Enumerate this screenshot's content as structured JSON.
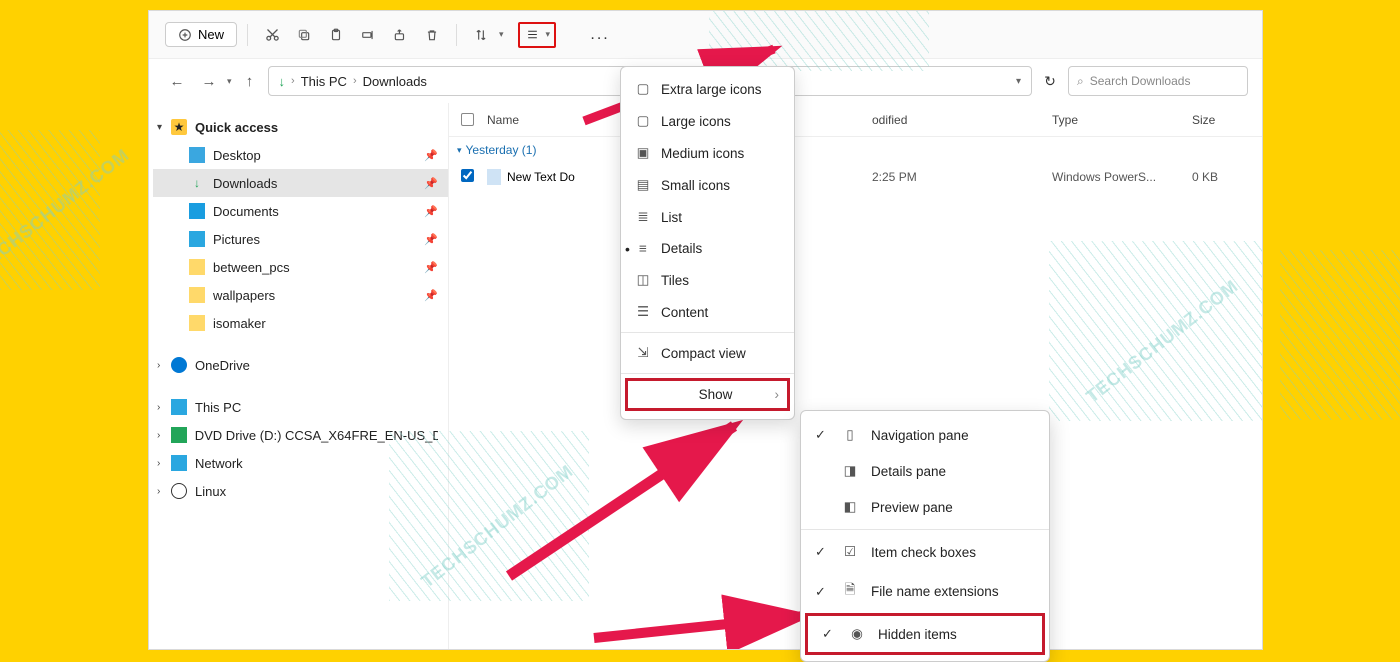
{
  "toolbar": {
    "new_label": "New",
    "more_label": "..."
  },
  "address": {
    "root": "This PC",
    "folder": "Downloads",
    "sep": "›"
  },
  "search": {
    "placeholder": "Search Downloads"
  },
  "sidebar": {
    "quick_access": "Quick access",
    "items": [
      {
        "label": "Desktop",
        "icon": "desktop"
      },
      {
        "label": "Downloads",
        "icon": "down",
        "active": true
      },
      {
        "label": "Documents",
        "icon": "doc"
      },
      {
        "label": "Pictures",
        "icon": "pic"
      },
      {
        "label": "between_pcs",
        "icon": "fold"
      },
      {
        "label": "wallpapers",
        "icon": "fold"
      },
      {
        "label": "isomaker",
        "icon": "fold"
      }
    ],
    "onedrive": "OneDrive",
    "thispc": "This PC",
    "dvd": "DVD Drive (D:) CCSA_X64FRE_EN-US_D",
    "network": "Network",
    "linux": "Linux"
  },
  "columns": {
    "name": "Name",
    "date": "odified",
    "type": "Type",
    "size": "Size"
  },
  "group": {
    "label": "Yesterday (1)"
  },
  "row": {
    "name": "New Text Do",
    "date": "2:25 PM",
    "type": "Windows PowerS...",
    "size": "0 KB"
  },
  "view_menu": {
    "items": [
      "Extra large icons",
      "Large icons",
      "Medium icons",
      "Small icons",
      "List",
      "Details",
      "Tiles",
      "Content"
    ],
    "compact": "Compact view",
    "show": "Show",
    "selected_index": 5
  },
  "show_menu": {
    "nav": "Navigation pane",
    "det": "Details pane",
    "pre": "Preview pane",
    "chk": "Item check boxes",
    "ext": "File name extensions",
    "hid": "Hidden items"
  },
  "watermark": "TECHSCHUMZ.COM"
}
